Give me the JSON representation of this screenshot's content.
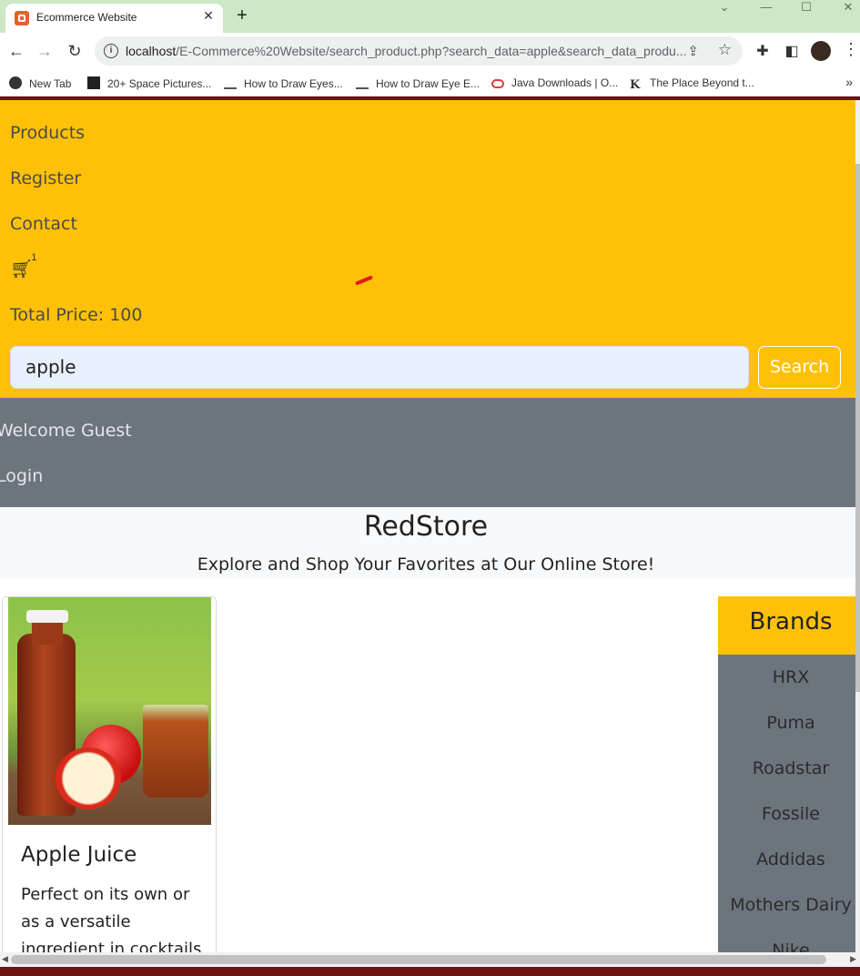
{
  "browser": {
    "tab_title": "Ecommerce Website",
    "tab_close": "✕",
    "new_tab": "+",
    "url_host": "localhost",
    "url_rest": "/E-Commerce%20Website/search_product.php?search_data=apple&search_data_produ...",
    "bookmarks": [
      {
        "label": "New Tab",
        "icon": "globe-icon"
      },
      {
        "label": "20+ Space Pictures...",
        "icon": "pixel-icon"
      },
      {
        "label": "How to Draw Eyes...",
        "icon": "pencil-icon"
      },
      {
        "label": "How to Draw Eye E...",
        "icon": "pencil-icon"
      },
      {
        "label": "Java Downloads | O...",
        "icon": "oracle-icon"
      },
      {
        "label": "The Place Beyond t...",
        "icon": "k-icon"
      }
    ],
    "bookmarks_more": "»"
  },
  "navbar": {
    "links": [
      "Products",
      "Register",
      "Contact"
    ],
    "cart_count": "1",
    "total_price": "Total Price: 100",
    "search_value": "apple",
    "search_button": "Search"
  },
  "secondary_nav": {
    "welcome": "Welcome Guest",
    "login": "Login"
  },
  "hero": {
    "title": "RedStore",
    "tagline": "Explore and Shop Your Favorites at Our Online Store!"
  },
  "product": {
    "name": "Apple Juice",
    "description": "Perfect on its own or as a versatile ingredient in cocktails"
  },
  "brands": {
    "heading": "Brands",
    "items": [
      "HRX",
      "Puma",
      "Roadstar",
      "Fossile",
      "Addidas",
      "Mothers Dairy",
      "Nike"
    ]
  },
  "colors": {
    "primary_yellow": "#ffc107",
    "secondary_gray": "#6c757d",
    "tabbar_green": "#cce8c4"
  }
}
